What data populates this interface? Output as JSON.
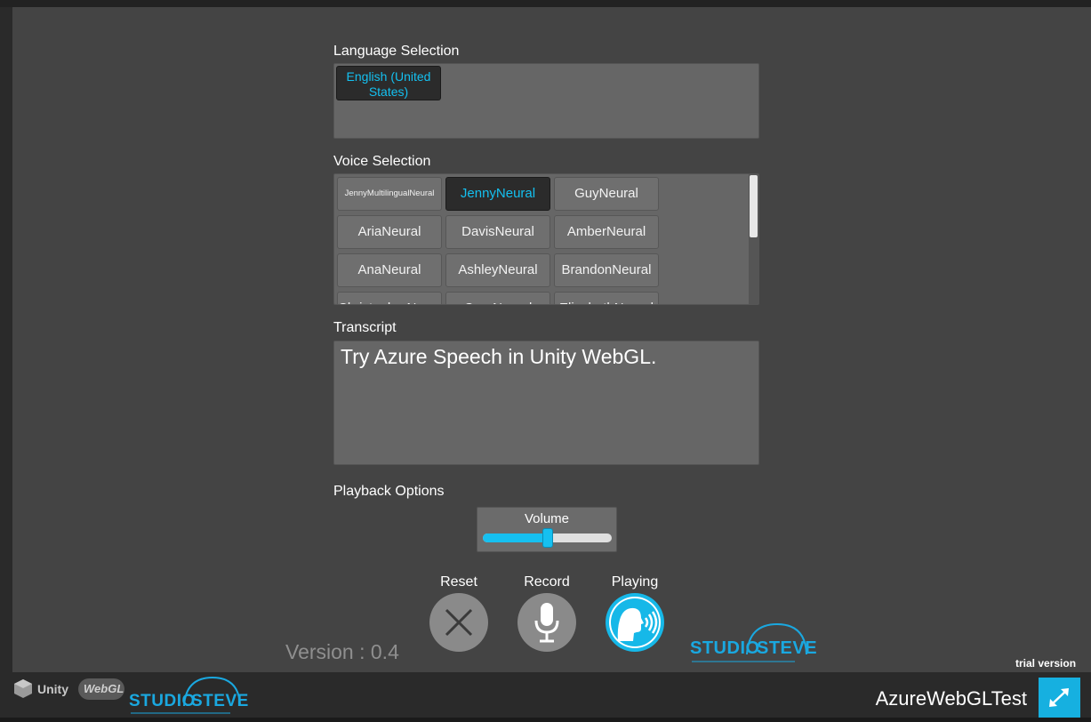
{
  "language": {
    "section_label": "Language Selection",
    "options": [
      {
        "label": "English (United States)",
        "selected": true
      }
    ]
  },
  "voice": {
    "section_label": "Voice Selection",
    "options": [
      {
        "label": "JennyMultilingualNeural",
        "selected": false
      },
      {
        "label": "JennyNeural",
        "selected": true
      },
      {
        "label": "GuyNeural",
        "selected": false
      },
      {
        "label": "AriaNeural",
        "selected": false
      },
      {
        "label": "DavisNeural",
        "selected": false
      },
      {
        "label": "AmberNeural",
        "selected": false
      },
      {
        "label": "AnaNeural",
        "selected": false
      },
      {
        "label": "AshleyNeural",
        "selected": false
      },
      {
        "label": "BrandonNeural",
        "selected": false
      },
      {
        "label": "ChristopherNeural",
        "selected": false
      },
      {
        "label": "CoraNeural",
        "selected": false
      },
      {
        "label": "ElizabethNeural",
        "selected": false
      }
    ]
  },
  "transcript": {
    "section_label": "Transcript",
    "text": "Try Azure Speech in Unity WebGL."
  },
  "playback": {
    "section_label": "Playback Options",
    "volume_label": "Volume",
    "volume_fraction": 0.5
  },
  "controls": {
    "reset_label": "Reset",
    "record_label": "Record",
    "playing_label": "Playing"
  },
  "version_text": "Version : 0.4",
  "logos": {
    "studio_text": "STUDIO",
    "steve_text": "STEVE",
    "unity_text": "Unity",
    "webgl_text": "WebGL"
  },
  "footer": {
    "trial_text": "trial version",
    "app_title": "AzureWebGLTest"
  },
  "colors": {
    "accent": "#16c0f0",
    "panel": "#666666",
    "background": "#444444"
  }
}
